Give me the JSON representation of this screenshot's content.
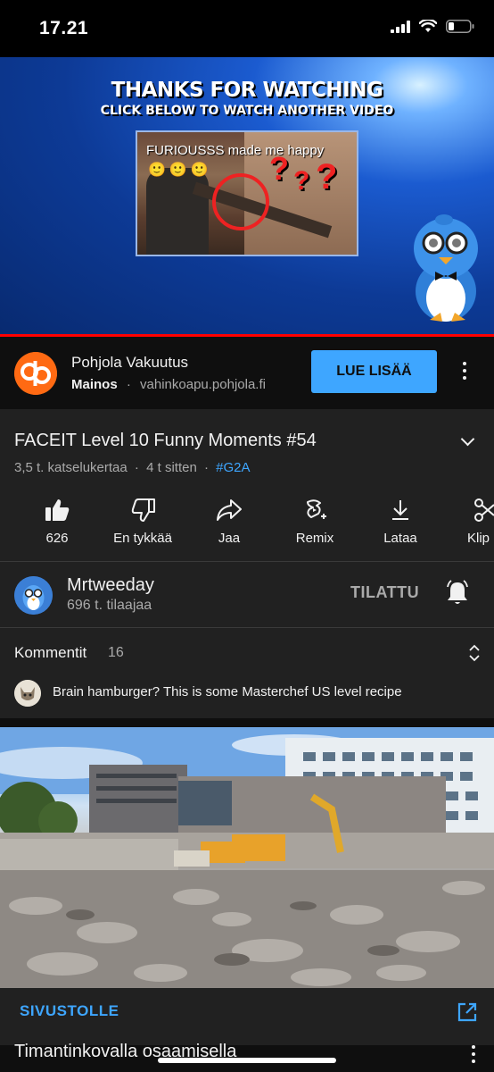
{
  "status_bar": {
    "time": "17.21"
  },
  "player": {
    "endcard_title": "THANKS FOR WATCHING",
    "endcard_subtitle": "CLICK BELOW TO WATCH ANOTHER VIDEO",
    "thumbnail_caption": "FURIOUSSS made me happy",
    "thumbnail_emoji": "🙂🙂🙂",
    "progress": 1.0
  },
  "ad": {
    "advertiser": "Pohjola Vakuutus",
    "label": "Mainos",
    "separator": "·",
    "domain": "vahinkoapu.pohjola.fi",
    "cta": "LUE LISÄÄ"
  },
  "video": {
    "title": "FACEIT Level 10 Funny Moments #54",
    "views": "3,5 t. katselukertaa",
    "age": "4 t sitten",
    "hashtag": "#G2A",
    "separator": "·"
  },
  "actions": {
    "like": "626",
    "dislike": "En tykkää",
    "share": "Jaa",
    "remix": "Remix",
    "download": "Lataa",
    "clip": "Klip"
  },
  "channel": {
    "name": "Mrtweeday",
    "subscribers": "696 t. tilaajaa",
    "subscribe_state": "TILATTU"
  },
  "comments": {
    "title": "Kommentit",
    "count": "16",
    "top_comment": "Brain hamburger? This is some Masterchef US level recipe"
  },
  "promo": {
    "cta": "SIVUSTOLLE",
    "title": "Timantinkovalla osaamisella"
  },
  "colors": {
    "accent_blue": "#3ea6ff",
    "progress_red": "#ff0000",
    "brand_orange": "#ff6a13",
    "surface": "#212121",
    "background": "#0f0f0f"
  }
}
